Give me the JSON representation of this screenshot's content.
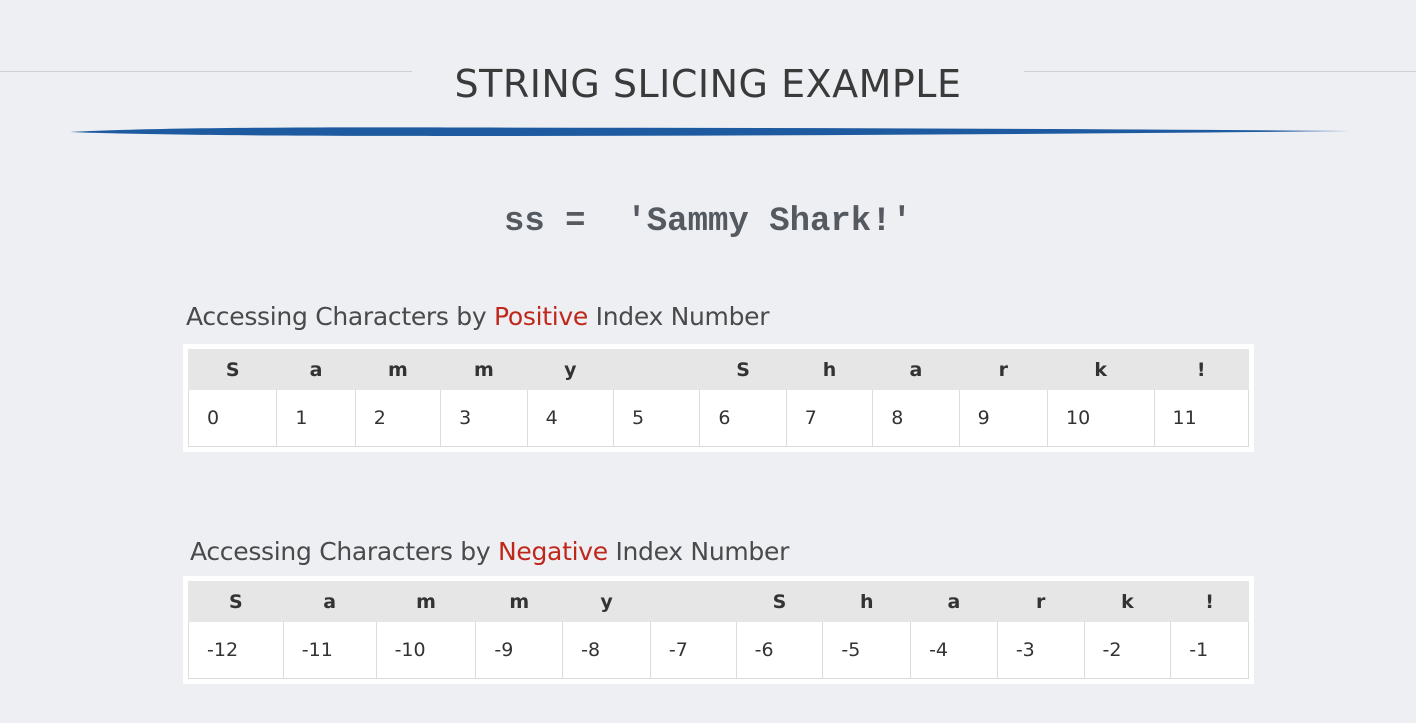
{
  "slide": {
    "title": "STRING SLICING EXAMPLE",
    "code": "ss =  'Sammy Shark!'",
    "accent_color": "#1d5aa0",
    "highlight_color": "#c0271b"
  },
  "positive": {
    "label_before": "Accessing Characters by ",
    "label_highlight": "Positive",
    "label_after": " Index Number",
    "chars": [
      "S",
      "a",
      "m",
      "m",
      "y",
      "",
      "S",
      "h",
      "a",
      "r",
      "k",
      "!"
    ],
    "indices": [
      "0",
      "1",
      "2",
      "3",
      "4",
      "5",
      "6",
      "7",
      "8",
      "9",
      "10",
      "11"
    ]
  },
  "negative": {
    "label_before": "Accessing Characters by ",
    "label_highlight": "Negative",
    "label_after": " Index Number",
    "chars": [
      "S",
      "a",
      "m",
      "m",
      "y",
      "",
      "S",
      "h",
      "a",
      "r",
      "k",
      "!"
    ],
    "indices": [
      "-12",
      "-11",
      "-10",
      "-9",
      "-8",
      "-7",
      "-6",
      "-5",
      "-4",
      "-3",
      "-2",
      "-1"
    ]
  }
}
